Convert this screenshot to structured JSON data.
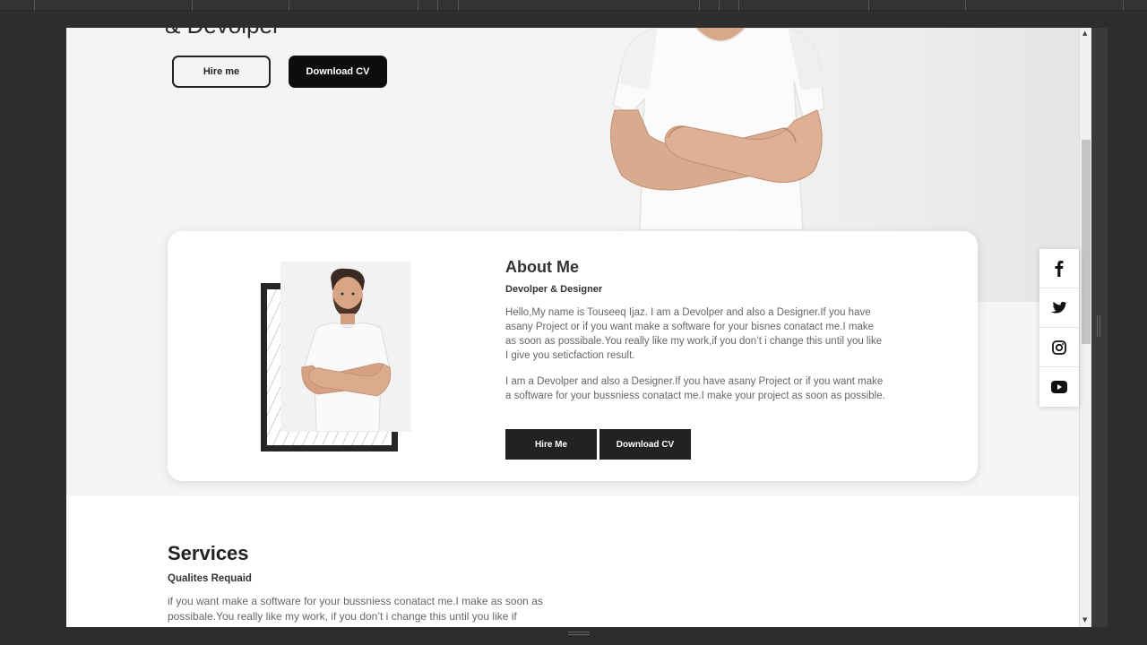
{
  "hero": {
    "heading": "& Devolper",
    "hire_button": "Hire me",
    "cv_button": "Download CV"
  },
  "about": {
    "title": "About Me",
    "subtitle": "Devolper & Designer",
    "paragraph1": "Hello,My name is Touseeq Ijaz. I am a Devolper and also a Designer.If you have asany Project or if you want make a software for your bisnes conatact me.I make as soon as possibale.You really like my work,if you don’t i change this until you like I give you seticfaction result.",
    "paragraph2": "I am a Devolper and also a Designer.If you have asany Project or if you want make a software for your bussniess conatact me.I make your project as soon as possible.",
    "hire_button": "Hire Me",
    "cv_button": "Download CV"
  },
  "services": {
    "title": "Services",
    "subtitle": "Qualites Requaid",
    "text": "if you want make a software for your bussniess conatact me.I make as soon as possibale.You really like my work, if you don’t i change this until you like if"
  },
  "social": {
    "icons": [
      "facebook-icon",
      "twitter-icon",
      "instagram-icon",
      "youtube-icon"
    ]
  },
  "colors": {
    "accent": "#222222",
    "hero_bg": "#f4f4f4",
    "chrome": "#2d2d2d"
  }
}
